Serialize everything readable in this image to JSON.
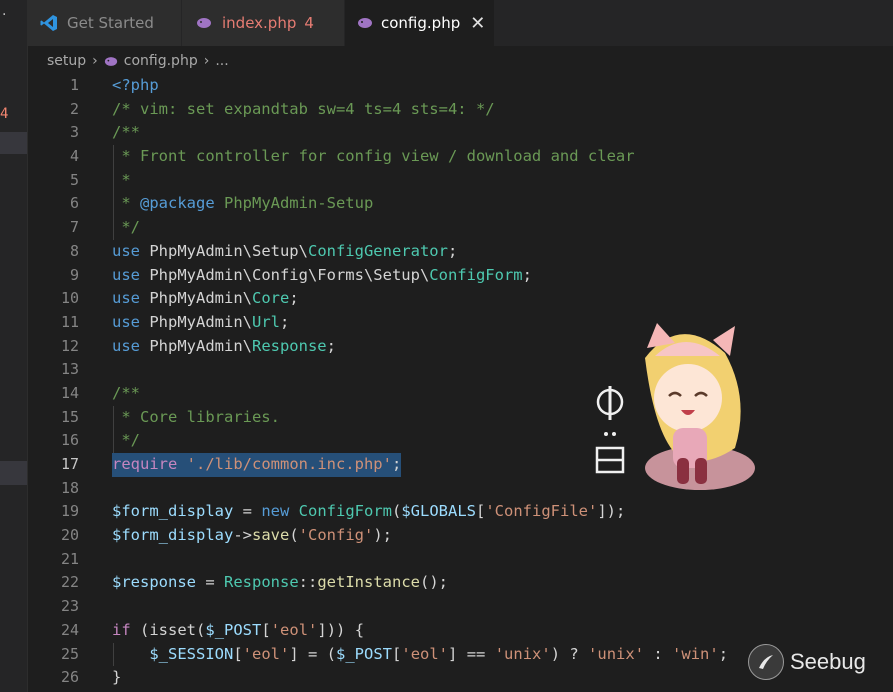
{
  "tabs": [
    {
      "label": "Get Started",
      "icon": "vscode-icon"
    },
    {
      "label": "index.php",
      "count": "4",
      "icon": "php-elephant-icon"
    },
    {
      "label": "config.php",
      "close": "✕",
      "icon": "php-elephant-icon"
    }
  ],
  "sidebar": {
    "dot": "·",
    "badge": "4"
  },
  "breadcrumb": {
    "folder": "setup",
    "file": "config.php",
    "more": "...",
    "sep": "›"
  },
  "editor": {
    "line_numbers": [
      "1",
      "2",
      "3",
      "4",
      "5",
      "6",
      "7",
      "8",
      "9",
      "10",
      "11",
      "12",
      "13",
      "14",
      "15",
      "16",
      "17",
      "18",
      "19",
      "20",
      "21",
      "22",
      "23",
      "24",
      "25",
      "26"
    ],
    "active_line": "17",
    "tokens": {
      "l1": "<?php",
      "l2": "/* vim: set expandtab sw=4 ts=4 sts=4: */",
      "l3": "/**",
      "l4": " * Front controller for config view / download and clear",
      "l5": " *",
      "l6a": " * ",
      "l6b": "@package",
      "l6c": " PhpMyAdmin-Setup",
      "l7": " */",
      "use": "use",
      "l8a": " PhpMyAdmin\\Setup\\",
      "l8b": "ConfigGenerator",
      "l9a": " PhpMyAdmin\\Config\\Forms\\Setup\\",
      "l9b": "ConfigForm",
      "l10a": " PhpMyAdmin\\",
      "l10b": "Core",
      "l11a": " PhpMyAdmin\\",
      "l11b": "Url",
      "l12a": " PhpMyAdmin\\",
      "l12b": "Response",
      "semi": ";",
      "l14": "/**",
      "l15": " * Core libraries.",
      "l16": " */",
      "l17a": "require",
      "l17b": " ",
      "l17c": "'./lib/common.inc.php'",
      "l19a": "$form_display",
      "l19b": " = ",
      "l19c": "new",
      "l19d": " ",
      "l19e": "ConfigForm",
      "l19f": "(",
      "l19g": "$GLOBALS",
      "l19h": "[",
      "l19i": "'ConfigFile'",
      "l19j": "]);",
      "l20a": "$form_display",
      "l20b": "->",
      "l20c": "save",
      "l20d": "(",
      "l20e": "'Config'",
      "l20f": ");",
      "l22a": "$response",
      "l22b": " = ",
      "l22c": "Response",
      "l22d": "::",
      "l22e": "getInstance",
      "l22f": "();",
      "l24a": "if",
      "l24b": " (",
      "l24c": "isset",
      "l24d": "(",
      "l24e": "$_POST",
      "l24f": "[",
      "l24g": "'eol'",
      "l24h": "])) {",
      "l25a": "    ",
      "l25b": "$_SESSION",
      "l25c": "[",
      "l25d": "'eol'",
      "l25e": "] = (",
      "l25f": "$_POST",
      "l25g": "[",
      "l25h": "'eol'",
      "l25i": "] == ",
      "l25j": "'unix'",
      "l25k": ") ? ",
      "l25l": "'unix'",
      "l25m": " : ",
      "l25n": "'win'",
      "l25o": ";",
      "l26": "}"
    }
  },
  "mascot": {
    "text": "中\n\n简"
  },
  "watermark": {
    "text": "Seebug",
    "icon": "seebug-logo-icon"
  },
  "colors": {
    "background": "#1e1e1e",
    "comment": "#6a9955",
    "keyword": "#569cd6",
    "control": "#c586c0",
    "class": "#4ec9b0",
    "string": "#ce9178",
    "variable": "#9cdcfe",
    "function": "#dcdcaa",
    "selection": "#264f78"
  }
}
